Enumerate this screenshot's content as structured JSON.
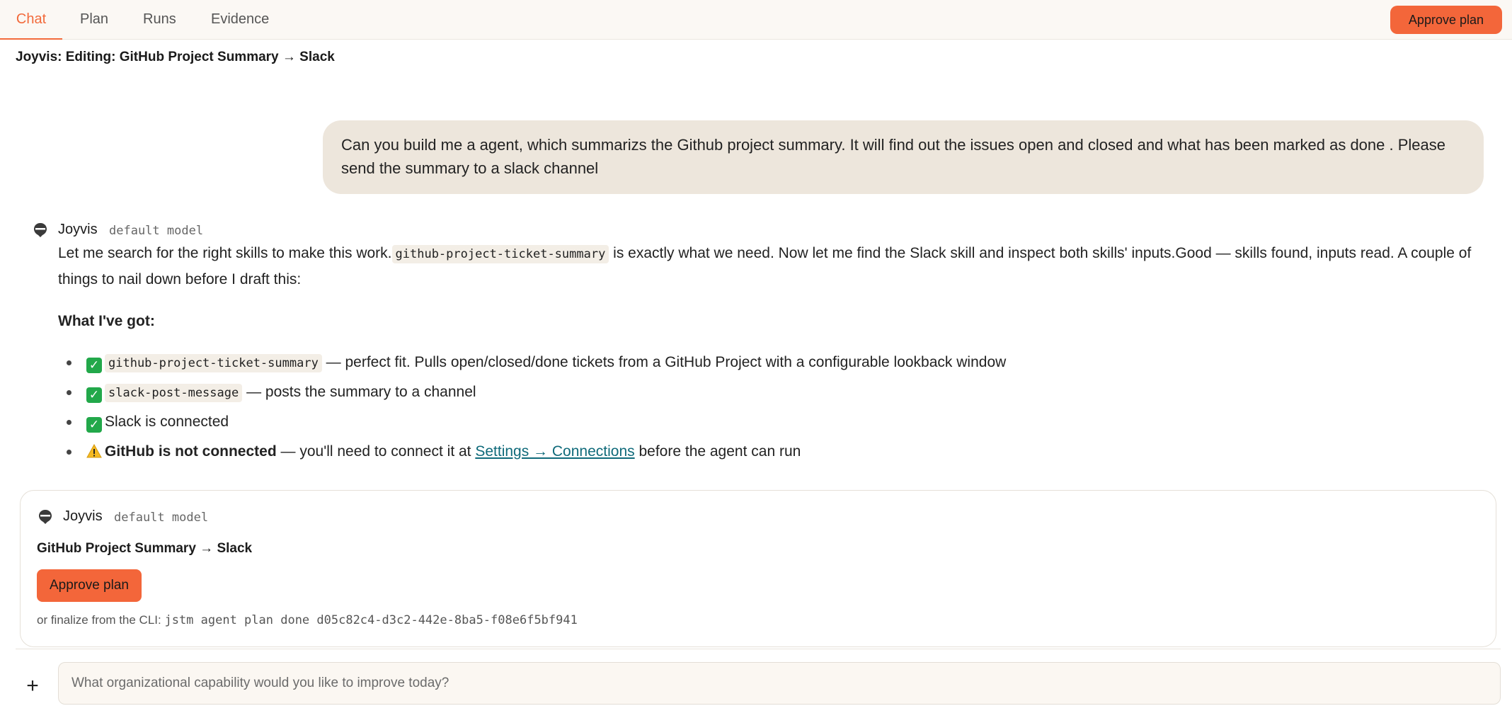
{
  "tabs": [
    "Chat",
    "Plan",
    "Runs",
    "Evidence"
  ],
  "active_tab": "Chat",
  "header": {
    "approve_label": "Approve plan"
  },
  "page_title": "Joyvis: Editing: GitHub Project Summary → Slack",
  "user_message": "Can you build me a agent, which summarizs the Github project summary. It will find out the issues open and closed and what has been marked as done . Please send the summary to a slack channel",
  "agent_reply": {
    "name": "Joyvis",
    "model": "default model",
    "intro_1": "Let me search for the right skills to make this work.",
    "intro_code": "github-project-ticket-summary",
    "intro_2": " is exactly what we need. Now let me find the Slack skill and inspect both skills' inputs.Good — skills found, inputs read. A couple of things to nail down before I draft this:",
    "heading": "What I've got:",
    "bullets": [
      {
        "icon": "check-icon",
        "code": "github-project-ticket-summary",
        "text": " — perfect fit. Pulls open/closed/done tickets from a GitHub Project with a configurable lookback window"
      },
      {
        "icon": "check-icon",
        "code": "slack-post-message",
        "text": " — posts the summary to a channel"
      },
      {
        "icon": "check-icon",
        "text": "Slack is connected"
      },
      {
        "icon": "warning-icon",
        "bold": "GitHub is not connected",
        "text_before": " — you'll need to connect it at ",
        "link": "Settings → Connections",
        "text_after": " before the agent can run"
      }
    ]
  },
  "plan_card": {
    "name": "Joyvis",
    "model": "default model",
    "title": "GitHub Project Summary → Slack",
    "approve_label": "Approve plan",
    "cli_prefix": "or finalize from the CLI: ",
    "cli_command": "jstm agent plan done d05c82c4-d3c2-442e-8ba5-f08e6f5bf941"
  },
  "composer": {
    "placeholder": "What organizational capability would you like to improve today?",
    "add_label": "+"
  },
  "colors": {
    "accent": "#f3663a",
    "user_bubble": "#ede6dc",
    "link": "#0f6a7a",
    "check": "#22a84a"
  }
}
